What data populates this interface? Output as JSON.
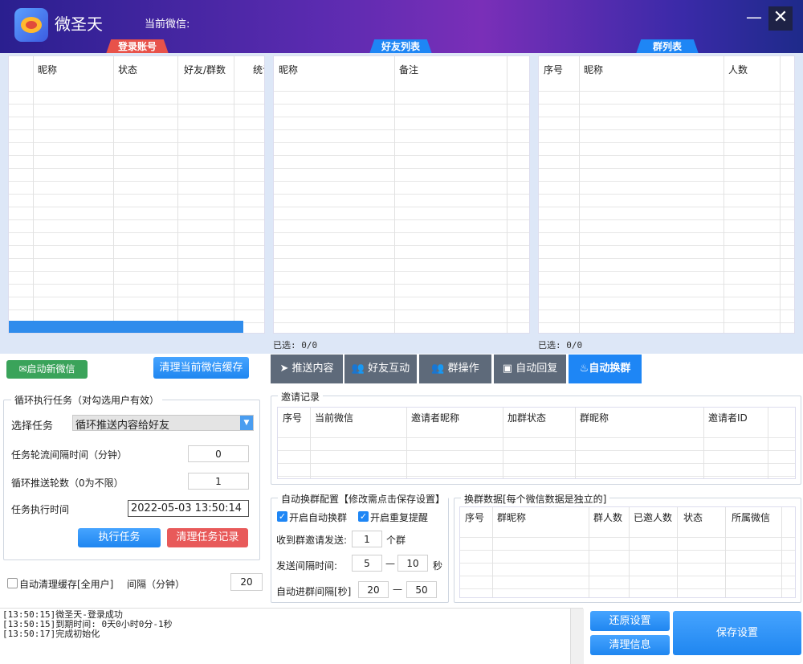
{
  "header": {
    "app_title": "微圣天",
    "current_wechat_label": "当前微信:",
    "minimize": "—",
    "close": "✕"
  },
  "section_tabs": {
    "login": "登录账号",
    "friends": "好友列表",
    "groups": "群列表"
  },
  "accounts_table": {
    "columns": [
      "昵称",
      "状态",
      "好友/群数",
      "统计"
    ]
  },
  "friends_table": {
    "columns": [
      "昵称",
      "备注"
    ],
    "selected": "已选: 0/0"
  },
  "groups_table": {
    "columns": [
      "序号",
      "昵称",
      "人数"
    ],
    "selected": "已选: 0/0"
  },
  "buttons": {
    "start_new_wechat": "启动新微信",
    "clear_cache": "清理当前微信缓存",
    "execute_task": "执行任务",
    "clear_task_log": "清理任务记录",
    "restore_settings": "还原设置",
    "clear_info": "清理信息",
    "save_settings": "保存设置"
  },
  "function_tabs": [
    {
      "label": "推送内容",
      "icon": "send-icon"
    },
    {
      "label": "好友互动",
      "icon": "users-icon"
    },
    {
      "label": "群操作",
      "icon": "group-icon"
    },
    {
      "label": "自动回复",
      "icon": "robot-icon"
    },
    {
      "label": "自动换群",
      "icon": "flame-icon",
      "active": true
    }
  ],
  "loop_task": {
    "title": "循环执行任务（对勾选用户有效）",
    "select_task_label": "选择任务",
    "select_task_value": "循环推送内容给好友",
    "interval_label": "任务轮流间隔时间（分钟）",
    "interval_value": "0",
    "rounds_label": "循环推送轮数（0为不限）",
    "rounds_value": "1",
    "exec_time_label": "任务执行时间",
    "exec_time_value": "2022-05-03 13:50:14"
  },
  "auto_clear": {
    "label": "自动清理缓存[全用户]",
    "interval_label": "间隔（分钟）",
    "interval_value": "20"
  },
  "invite_records": {
    "title": "邀请记录",
    "columns": [
      "序号",
      "当前微信",
      "邀请者昵称",
      "加群状态",
      "群昵称",
      "邀请者ID"
    ]
  },
  "auto_switch_config": {
    "title": "自动换群配置【修改需点击保存设置】",
    "enable_switch": "开启自动换群",
    "enable_repeat_remind": "开启重复提醒",
    "receive_label": "收到群邀请发送:",
    "receive_value": "1",
    "receive_unit": "个群",
    "send_interval_label": "发送间隔时间:",
    "send_min": "5",
    "send_max": "10",
    "send_unit": "秒",
    "join_interval_label": "自动进群间隔[秒]",
    "join_min": "20",
    "join_max": "50",
    "dash": "—"
  },
  "switch_data": {
    "title": "换群数据[每个微信数据是独立的]",
    "columns": [
      "序号",
      "群昵称",
      "群人数",
      "已邀人数",
      "状态",
      "所属微信"
    ]
  },
  "log": [
    "[13:50:15]微圣天-登录成功",
    "[13:50:15]到期时间: 0天0小时0分-1秒",
    "[13:50:17]完成初始化"
  ],
  "colors": {
    "accent": "#1e86f5",
    "tab_login": "#e8524a",
    "tab_blue": "#1e86f5",
    "danger": "#e85a5a",
    "success": "#3aa35a"
  }
}
